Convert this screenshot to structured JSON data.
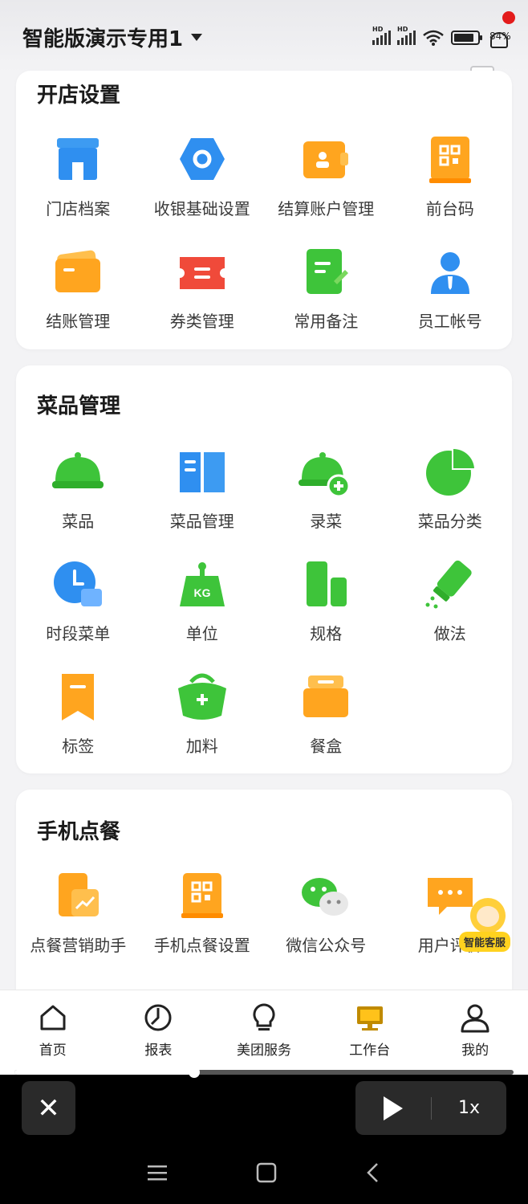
{
  "status_bar": {
    "store_name": "智能版演示专用1",
    "signal_label": "HD",
    "battery_percent": "84%"
  },
  "sections": [
    {
      "title": "开店设置",
      "items": [
        {
          "label": "门店档案",
          "icon": "store-icon"
        },
        {
          "label": "收银基础设置",
          "icon": "cashier-settings-icon"
        },
        {
          "label": "结算账户管理",
          "icon": "wallet-icon"
        },
        {
          "label": "前台码",
          "icon": "qr-code-icon"
        },
        {
          "label": "结账管理",
          "icon": "card-icon"
        },
        {
          "label": "券类管理",
          "icon": "coupon-icon"
        },
        {
          "label": "常用备注",
          "icon": "note-icon"
        },
        {
          "label": "员工帐号",
          "icon": "user-icon"
        }
      ]
    },
    {
      "title": "菜品管理",
      "items": [
        {
          "label": "菜品",
          "icon": "cloche-icon"
        },
        {
          "label": "菜品管理",
          "icon": "book-icon"
        },
        {
          "label": "录菜",
          "icon": "cloche-add-icon"
        },
        {
          "label": "菜品分类",
          "icon": "pie-icon"
        },
        {
          "label": "时段菜单",
          "icon": "clock-icon"
        },
        {
          "label": "单位",
          "icon": "weight-icon",
          "text": "KG"
        },
        {
          "label": "规格",
          "icon": "cups-icon"
        },
        {
          "label": "做法",
          "icon": "seasoning-icon"
        },
        {
          "label": "标签",
          "icon": "tag-icon"
        },
        {
          "label": "加料",
          "icon": "add-bag-icon"
        },
        {
          "label": "餐盒",
          "icon": "box-icon"
        }
      ]
    },
    {
      "title": "手机点餐",
      "items": [
        {
          "label": "点餐营销助手",
          "icon": "marketing-icon"
        },
        {
          "label": "手机点餐设置",
          "icon": "mobile-qr-icon"
        },
        {
          "label": "微信公众号",
          "icon": "wechat-icon"
        },
        {
          "label": "用户评价",
          "icon": "comment-icon"
        }
      ]
    }
  ],
  "helper": {
    "label": "智能客服"
  },
  "tabs": [
    {
      "label": "首页",
      "icon": "home-icon"
    },
    {
      "label": "报表",
      "icon": "report-icon"
    },
    {
      "label": "美团服务",
      "icon": "bulb-icon"
    },
    {
      "label": "工作台",
      "icon": "workbench-icon",
      "active": true
    },
    {
      "label": "我的",
      "icon": "profile-icon"
    }
  ],
  "player": {
    "progress": 0.36,
    "speed": "1x",
    "close_symbol": "✕"
  },
  "colors": {
    "orange": "#ffa51f",
    "green": "#3ec43a",
    "blue": "#2f8ff0",
    "red": "#f04a3a",
    "active_tab": "#c08a00"
  }
}
